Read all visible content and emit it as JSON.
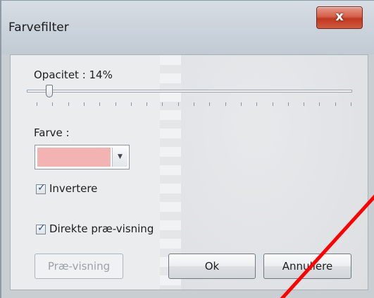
{
  "window": {
    "title": "Farvefilter",
    "close_glyph": "x"
  },
  "opacity": {
    "label": "Opacitet : 14%",
    "value_percent": 14
  },
  "color": {
    "label": "Farve :",
    "swatch_color": "#f2b3b2",
    "arrow_glyph": "▼"
  },
  "checkboxes": {
    "invert": {
      "label": "Invertere",
      "checked": true
    },
    "live_preview": {
      "label": "Direkte præ-visning",
      "checked": true
    },
    "check_glyph": "✓"
  },
  "buttons": {
    "preview": "Præ-visning",
    "ok": "Ok",
    "cancel": "Annullere"
  },
  "overlay": {
    "line_color": "#ff0000"
  }
}
